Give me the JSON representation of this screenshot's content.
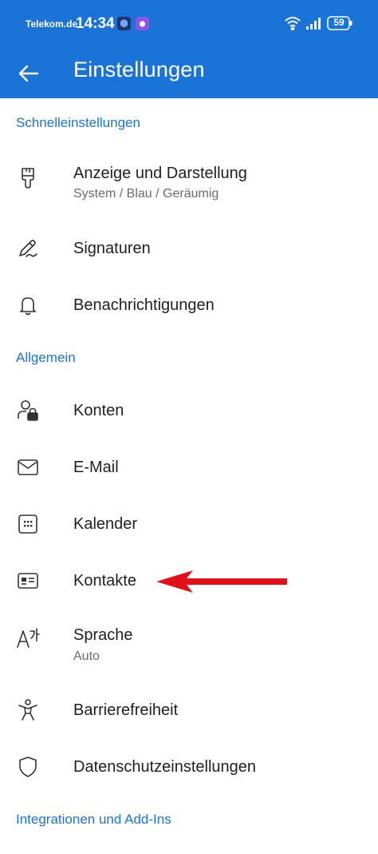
{
  "status_bar": {
    "carrier": "Telekom.de",
    "time": "14:34",
    "battery": "59"
  },
  "header": {
    "back_icon": "arrow-left-icon",
    "title": "Einstellungen"
  },
  "sections": {
    "quick": {
      "title": "Schnelleinstellungen",
      "display": {
        "icon": "brush-icon",
        "label": "Anzeige und Darstellung",
        "sub": "System / Blau / Geräumig"
      },
      "signatures": {
        "icon": "signature-pen-icon",
        "label": "Signaturen"
      },
      "notifications": {
        "icon": "bell-icon",
        "label": "Benachrichtigungen"
      }
    },
    "general": {
      "title": "Allgemein",
      "accounts": {
        "icon": "person-lock-icon",
        "label": "Konten"
      },
      "email": {
        "icon": "envelope-icon",
        "label": "E-Mail"
      },
      "calendar": {
        "icon": "calendar-icon",
        "label": "Kalender"
      },
      "contacts": {
        "icon": "contact-card-icon",
        "label": "Kontakte"
      },
      "language": {
        "icon": "language-icon",
        "label": "Sprache",
        "sub": "Auto"
      },
      "accessibility": {
        "icon": "accessibility-icon",
        "label": "Barrierefreiheit"
      },
      "privacy": {
        "icon": "shield-icon",
        "label": "Datenschutzeinstellungen"
      }
    },
    "integrations": {
      "title": "Integrationen und Add-Ins"
    }
  },
  "annotation": {
    "icon": "red-arrow-icon",
    "color": "#e3101a"
  },
  "colors": {
    "accent": "#1a73d6",
    "text": "#1f1f1f",
    "secondary": "#6b6b6b"
  }
}
